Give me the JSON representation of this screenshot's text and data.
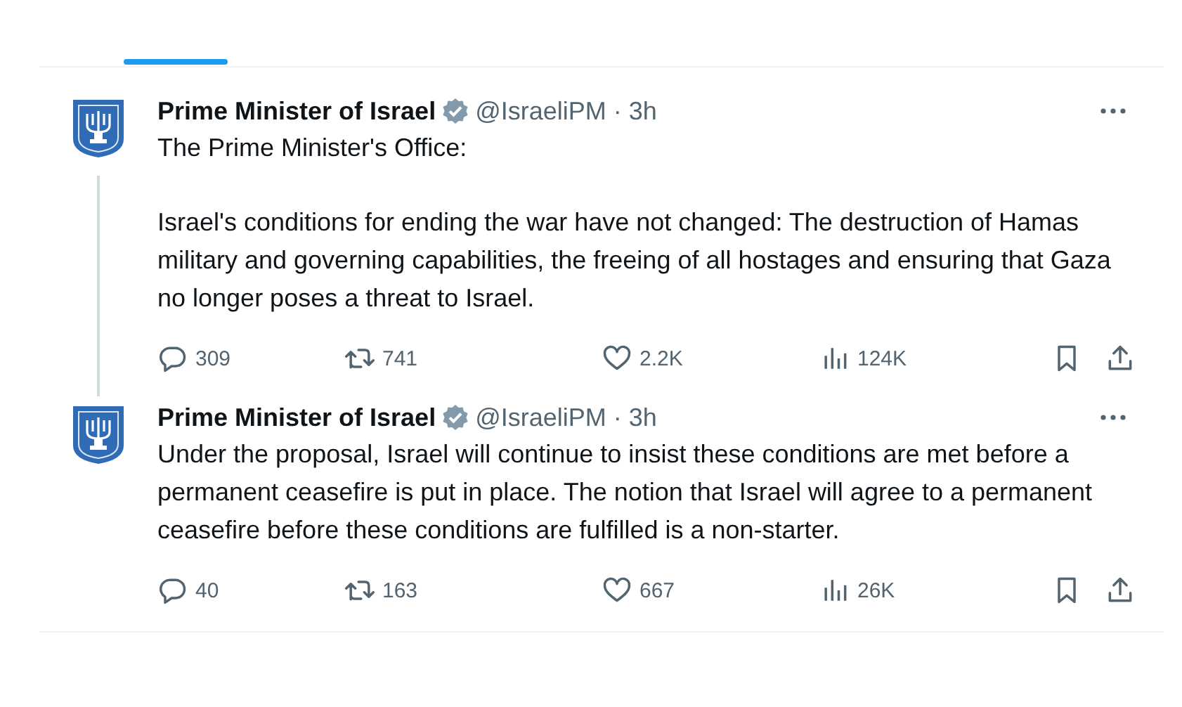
{
  "tweets": [
    {
      "author": "Prime Minister of Israel",
      "verified": true,
      "handle": "@IsraeliPM",
      "time": "· 3h",
      "thread_continues": true,
      "paragraphs": [
        "The Prime Minister's Office:",
        "Israel's conditions for ending the war have not changed: The destruction of Hamas military and governing capabilities, the freeing of all hostages and ensuring that Gaza no longer poses a threat to Israel."
      ],
      "stats": {
        "replies": "309",
        "reposts": "741",
        "likes": "2.2K",
        "views": "124K"
      }
    },
    {
      "author": "Prime Minister of Israel",
      "verified": true,
      "handle": "@IsraeliPM",
      "time": "· 3h",
      "thread_continues": false,
      "paragraphs": [
        "Under the proposal, Israel will continue to insist these conditions are met before a permanent ceasefire is put in place. The notion that Israel will agree to a permanent ceasefire before these conditions are fulfilled is a non-starter."
      ],
      "stats": {
        "replies": "40",
        "reposts": "163",
        "likes": "667",
        "views": "26K"
      }
    }
  ]
}
